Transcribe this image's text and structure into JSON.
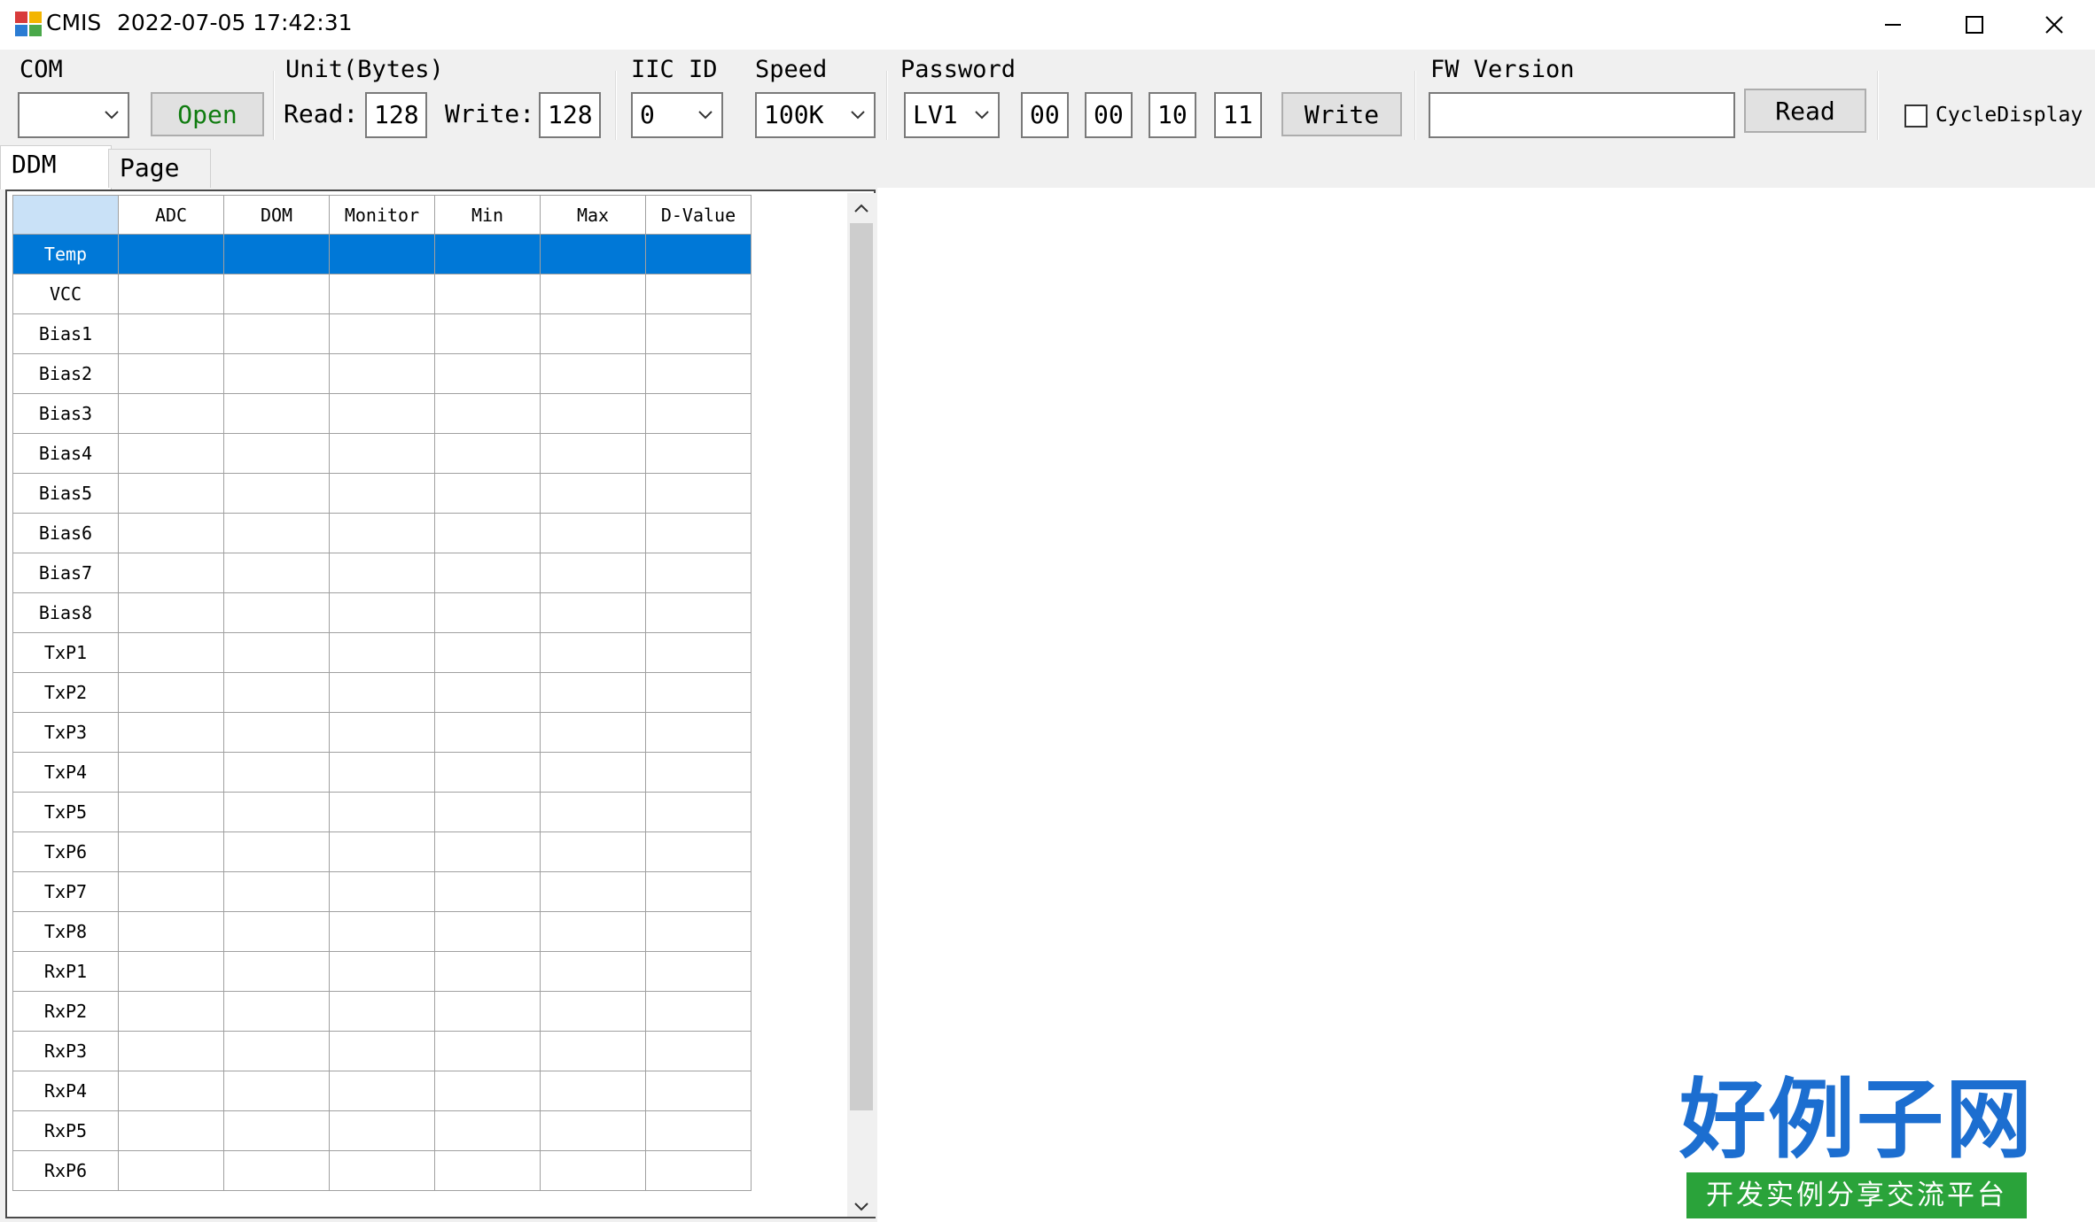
{
  "window": {
    "app_name": "CMIS",
    "datetime": "2022-07-05 17:42:31"
  },
  "toolbar": {
    "com": {
      "label": "COM",
      "value": "",
      "open_button": "Open"
    },
    "unit": {
      "label": "Unit(Bytes)",
      "read_label": "Read:",
      "read_value": "128",
      "write_label": "Write:",
      "write_value": "128"
    },
    "iic": {
      "label": "IIC ID",
      "value": "0"
    },
    "speed": {
      "label": "Speed",
      "value": "100K"
    },
    "password": {
      "label": "Password",
      "level": "LV1",
      "bytes": [
        "00",
        "00",
        "10",
        "11"
      ],
      "write_button": "Write"
    },
    "fw": {
      "label": "FW Version",
      "value": "",
      "read_button": "Read"
    },
    "cycle_display": {
      "label": "CycleDisplay",
      "checked": false
    }
  },
  "tabs": [
    "DDM",
    "Page"
  ],
  "grid": {
    "columns": [
      "ADC",
      "DOM",
      "Monitor",
      "Min",
      "Max",
      "D-Value"
    ],
    "rows": [
      "Temp",
      "VCC",
      "Bias1",
      "Bias2",
      "Bias3",
      "Bias4",
      "Bias5",
      "Bias6",
      "Bias7",
      "Bias8",
      "TxP1",
      "TxP2",
      "TxP3",
      "TxP4",
      "TxP5",
      "TxP6",
      "TxP7",
      "TxP8",
      "RxP1",
      "RxP2",
      "RxP3",
      "RxP4",
      "RxP5",
      "RxP6"
    ],
    "selected_row": "Temp"
  },
  "watermark": {
    "logo_main": "好例子网",
    "logo_sub": "开发实例分享交流平台"
  },
  "colors": {
    "selection": "#0078d7",
    "open_button_text": "#107c10",
    "logo_blue": "#1c6ed0",
    "logo_green": "#2aa33a"
  }
}
